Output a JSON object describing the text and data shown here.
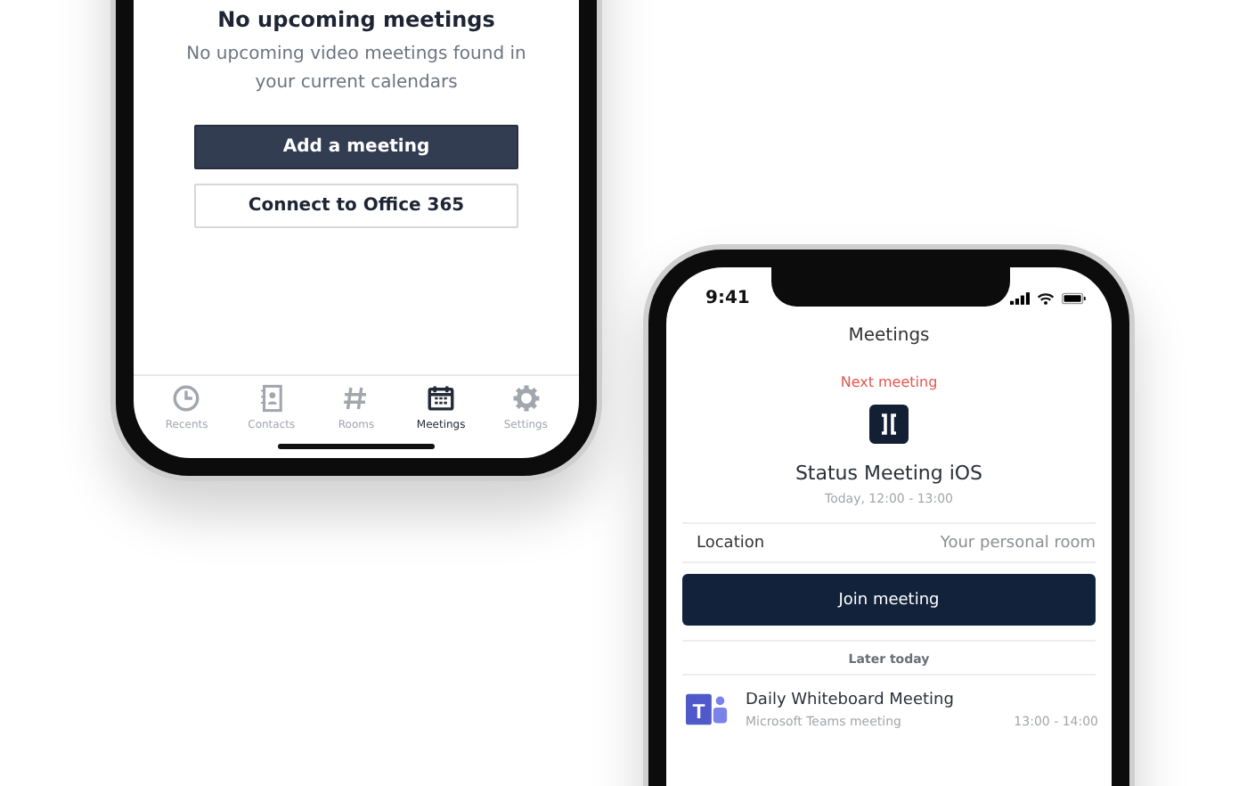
{
  "phones": [
    {
      "kind": "empty",
      "title": "No upcoming meetings",
      "description": "No upcoming video meetings found in your current calendars",
      "buttons": [
        {
          "label": "Add a meeting",
          "kind": "primary"
        },
        {
          "label": "Connect to Office 365",
          "kind": "secondary"
        }
      ],
      "tabs": [
        {
          "label": "Recents",
          "selected": false
        },
        {
          "label": "Contacts",
          "selected": false
        },
        {
          "label": "Rooms",
          "selected": false
        },
        {
          "label": "Meetings",
          "selected": true
        },
        {
          "label": "Settings",
          "selected": false
        }
      ]
    },
    {
      "kind": "meetings",
      "status_bar": {
        "time": "9:41"
      },
      "title": "Meetings",
      "next_label": "Next meeting",
      "meeting_title": "Status Meeting iOS",
      "meeting_time": "Today, 12:00 - 13:00",
      "location": {
        "label": "Location",
        "value": "Your personal room"
      },
      "join_button": "Join meeting",
      "section": "Later today",
      "rows": [
        {
          "title": "Daily Whiteboard Meeting",
          "subtitle": "Microsoft Teams meeting",
          "time": "13:00 - 14:00",
          "icon_letter": "T"
        }
      ]
    }
  ]
}
